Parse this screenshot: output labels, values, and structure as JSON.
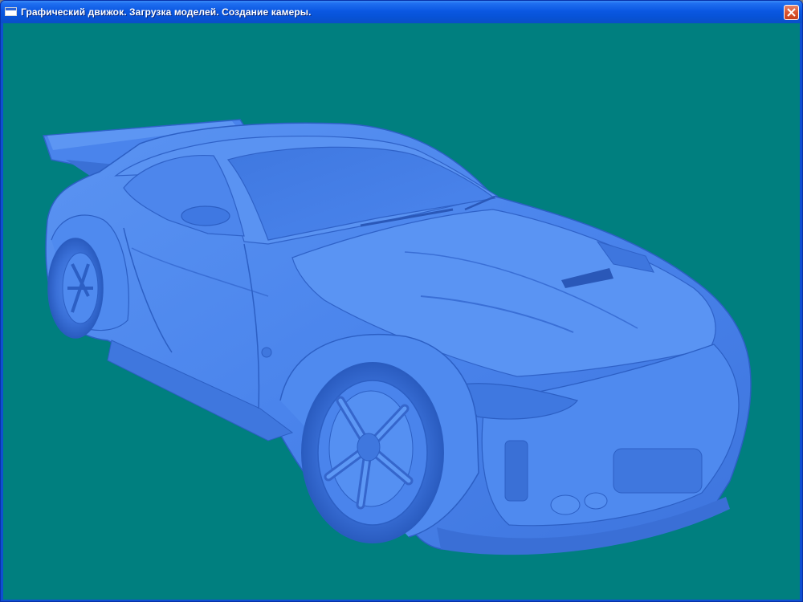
{
  "window": {
    "title": "Графический движок. Загрузка моделей. Создание камеры.",
    "viewport_background": "#007f7f",
    "model_color": "#4d88f0"
  },
  "icons": {
    "app": "window-icon",
    "close": "close-x-icon"
  }
}
